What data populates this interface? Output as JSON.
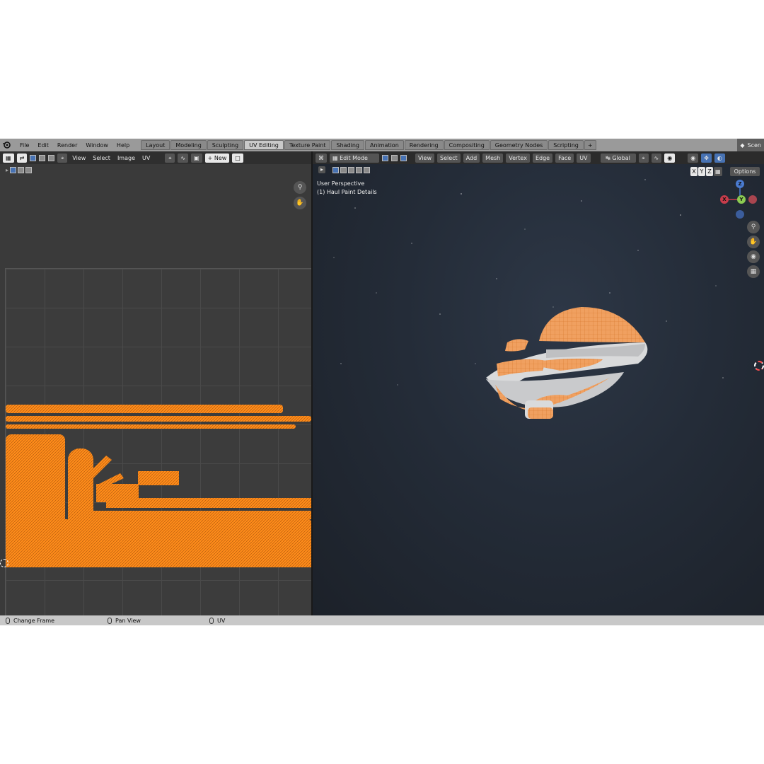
{
  "menu": [
    "File",
    "Edit",
    "Render",
    "Window",
    "Help"
  ],
  "workspaces": [
    {
      "label": "Layout",
      "active": false
    },
    {
      "label": "Modeling",
      "active": false
    },
    {
      "label": "Sculpting",
      "active": false
    },
    {
      "label": "UV Editing",
      "active": true
    },
    {
      "label": "Texture Paint",
      "active": false
    },
    {
      "label": "Shading",
      "active": false
    },
    {
      "label": "Animation",
      "active": false
    },
    {
      "label": "Rendering",
      "active": false
    },
    {
      "label": "Compositing",
      "active": false
    },
    {
      "label": "Geometry Nodes",
      "active": false
    },
    {
      "label": "Scripting",
      "active": false
    }
  ],
  "add_tab": "+",
  "scene_label": "Scen",
  "uv_editor": {
    "menus": [
      "View",
      "Select",
      "Image",
      "UV"
    ],
    "new_label": "New"
  },
  "viewport": {
    "mode": "Edit Mode",
    "menus": [
      "View",
      "Select",
      "Add",
      "Mesh",
      "Vertex",
      "Edge",
      "Face",
      "UV"
    ],
    "transform_orientation": "Global",
    "axes": [
      "X",
      "Y",
      "Z"
    ],
    "options_label": "Options",
    "overlay_title": "User Perspective",
    "overlay_object": "(1) Haul Paint Details",
    "gizmo": {
      "x": "X",
      "y": "Y",
      "z": "Z"
    }
  },
  "status": {
    "left": "Change Frame",
    "middle": "Pan View",
    "right": "UV"
  },
  "colors": {
    "accent": "#4772b3",
    "uv_island": "#ff8c1a",
    "ship_body": "#d9dadb"
  },
  "icons": [
    "blender-logo-icon",
    "zoom-icon",
    "hand-icon",
    "camera-icon",
    "grid-icon",
    "mouse-icon",
    "cursor-icon"
  ]
}
